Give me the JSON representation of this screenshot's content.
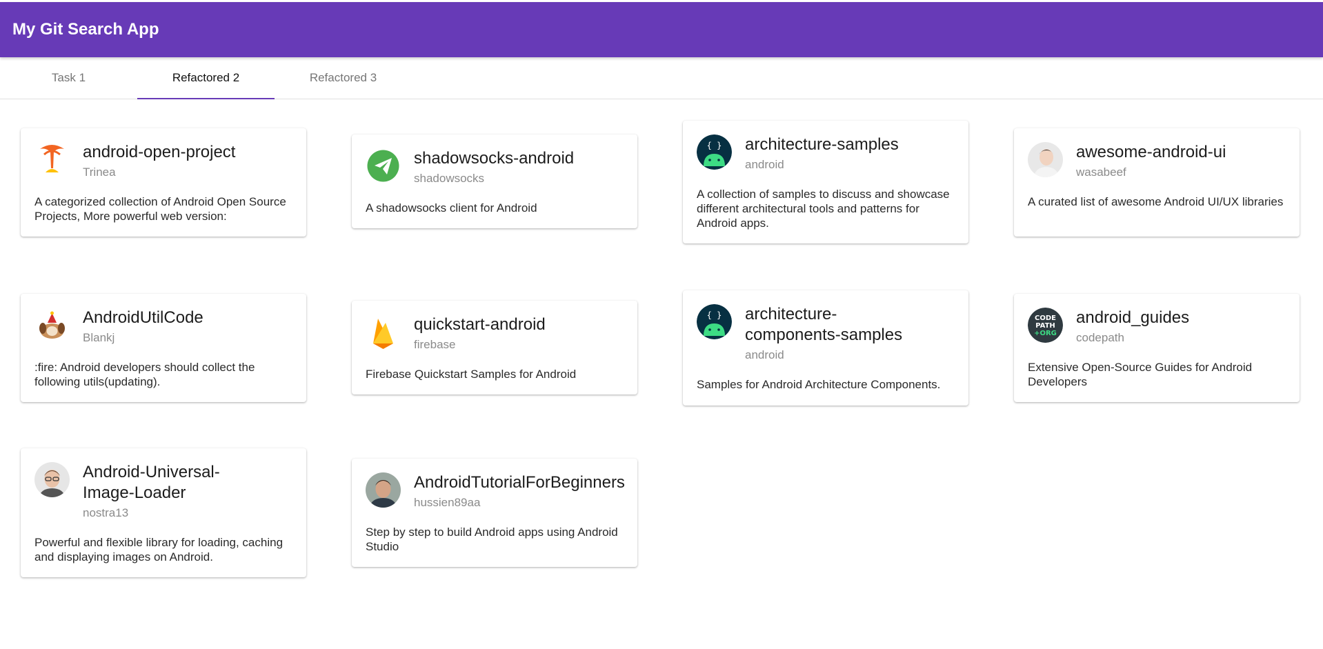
{
  "app": {
    "title": "My Git Search App",
    "accent": "#673ab7"
  },
  "tabs": [
    {
      "label": "Task 1",
      "active": false
    },
    {
      "label": "Refactored 2",
      "active": true
    },
    {
      "label": "Refactored 3",
      "active": false
    }
  ],
  "repos": [
    {
      "name": "android-open-project",
      "owner": "Trinea",
      "description": "A categorized collection of Android Open Source Projects, More powerful web version:",
      "avatar": "tree-logo-icon"
    },
    {
      "name": "shadowsocks-android",
      "owner": "shadowsocks",
      "description": "A shadowsocks client for Android",
      "avatar": "paper-plane-icon"
    },
    {
      "name": "architecture-samples",
      "owner": "android",
      "description": "A collection of samples to discuss and showcase different architectural tools and patterns for Android apps.",
      "avatar": "android-braces-icon"
    },
    {
      "name": "awesome-android-ui",
      "owner": "wasabeef",
      "description": "A curated list of awesome Android UI/UX libraries",
      "avatar": "user-photo-icon"
    },
    {
      "name": "AndroidUtilCode",
      "owner": "Blankj",
      "description": ":fire: Android developers should collect the following utils(updating).",
      "avatar": "dog-icon"
    },
    {
      "name": "quickstart-android",
      "owner": "firebase",
      "description": "Firebase Quickstart Samples for Android",
      "avatar": "firebase-flame-icon"
    },
    {
      "name": "architecture-components-samples",
      "name_line1": "architecture-",
      "name_line2": "components-samples",
      "owner": "android",
      "description": "Samples for Android Architecture Components.",
      "avatar": "android-braces-icon"
    },
    {
      "name": "android_guides",
      "owner": "codepath",
      "description": "Extensive Open-Source Guides for Android Developers",
      "avatar": "codepath-logo-icon",
      "avatar_text": [
        "CODE",
        "PATH",
        "+ORG"
      ]
    },
    {
      "name": "Android-Universal-Image-Loader",
      "name_line1": "Android-Universal-",
      "name_line2": "Image-Loader",
      "owner": "nostra13",
      "description": "Powerful and flexible library for loading, caching and displaying images on Android.",
      "avatar": "user-photo-icon"
    },
    {
      "name": "AndroidTutorialForBeginners",
      "owner": "hussien89aa",
      "description": "Step by step to build Android apps using Android Studio",
      "avatar": "user-photo-icon"
    }
  ]
}
